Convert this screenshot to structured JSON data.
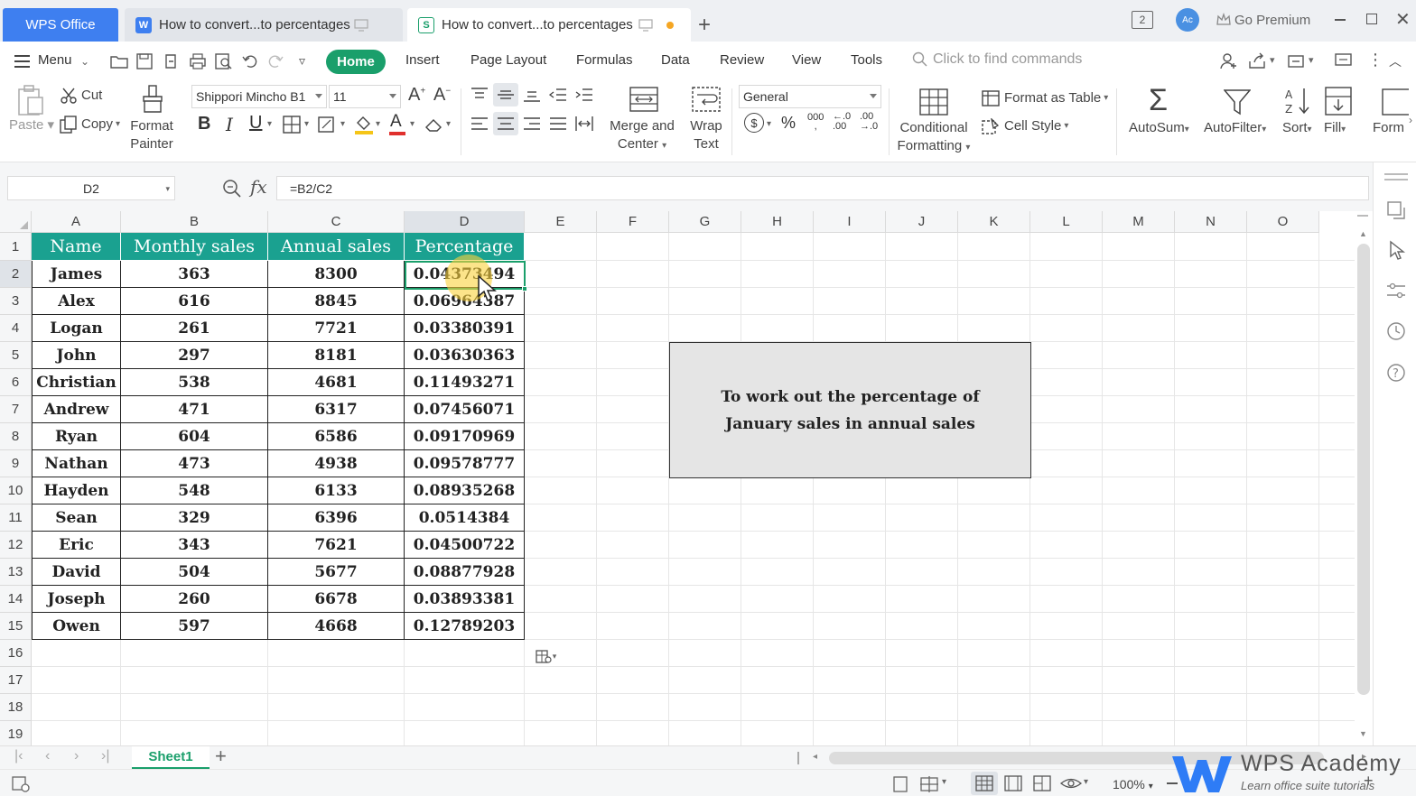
{
  "titlebar": {
    "app_tab": "WPS Office",
    "tabs": [
      {
        "label": "How to convert...to percentages",
        "type": "writer"
      },
      {
        "label": "How to convert...to percentages",
        "type": "sheet"
      }
    ],
    "premium_label": "Go Premium",
    "avatar": "Ac",
    "window_count": "2"
  },
  "menubar": {
    "menu_label": "Menu",
    "items": [
      "Home",
      "Insert",
      "Page Layout",
      "Formulas",
      "Data",
      "Review",
      "View",
      "Tools"
    ],
    "search_placeholder": "Click to find commands"
  },
  "ribbon": {
    "paste": "Paste",
    "cut": "Cut",
    "copy": "Copy",
    "format_painter_1": "Format",
    "format_painter_2": "Painter",
    "font_name": "Shippori Mincho B1",
    "font_size": "11",
    "merge_1": "Merge and",
    "merge_2": "Center",
    "wrap_1": "Wrap",
    "wrap_2": "Text",
    "number_format": "General",
    "cond_1": "Conditional",
    "cond_2": "Formatting",
    "format_table": "Format as Table",
    "cell_style": "Cell Style",
    "autosum": "AutoSum",
    "autofilter": "AutoFilter",
    "sort": "Sort",
    "fill": "Fill",
    "form": "Form"
  },
  "formula_bar": {
    "cell_ref": "D2",
    "formula": "=B2/C2",
    "fx": "fx"
  },
  "grid": {
    "columns": [
      "A",
      "B",
      "C",
      "D",
      "E",
      "F",
      "G",
      "H",
      "I",
      "J",
      "K",
      "L",
      "M",
      "N",
      "O"
    ],
    "rows": [
      "1",
      "2",
      "3",
      "4",
      "5",
      "6",
      "7",
      "8",
      "9",
      "10",
      "11",
      "12",
      "13",
      "14",
      "15",
      "16",
      "17",
      "18",
      "19"
    ],
    "header": [
      "Name",
      "Monthly sales",
      "Annual sales",
      "Percentage"
    ],
    "data": [
      [
        "James",
        "363",
        "8300",
        "0.04373494"
      ],
      [
        "Alex",
        "616",
        "8845",
        "0.06964387"
      ],
      [
        "Logan",
        "261",
        "7721",
        "0.03380391"
      ],
      [
        "John",
        "297",
        "8181",
        "0.03630363"
      ],
      [
        "Christian",
        "538",
        "4681",
        "0.11493271"
      ],
      [
        "Andrew",
        "471",
        "6317",
        "0.07456071"
      ],
      [
        "Ryan",
        "604",
        "6586",
        "0.09170969"
      ],
      [
        "Nathan",
        "473",
        "4938",
        "0.09578777"
      ],
      [
        "Hayden",
        "548",
        "6133",
        "0.08935268"
      ],
      [
        "Sean",
        "329",
        "6396",
        "0.0514384"
      ],
      [
        "Eric",
        "343",
        "7621",
        "0.04500722"
      ],
      [
        "David",
        "504",
        "5677",
        "0.08877928"
      ],
      [
        "Joseph",
        "260",
        "6678",
        "0.03893381"
      ],
      [
        "Owen",
        "597",
        "4668",
        "0.12789203"
      ]
    ],
    "note": "To work out the percentage of January sales in annual sales"
  },
  "sheets": {
    "active": "Sheet1"
  },
  "status": {
    "zoom": "100%"
  },
  "watermark": {
    "brand": "WPS Academy",
    "tagline": "Learn office suite tutorials"
  },
  "colors": {
    "accent": "#1a9f6b",
    "header_fill": "#1aa190",
    "wps_blue": "#3e7ff0"
  }
}
